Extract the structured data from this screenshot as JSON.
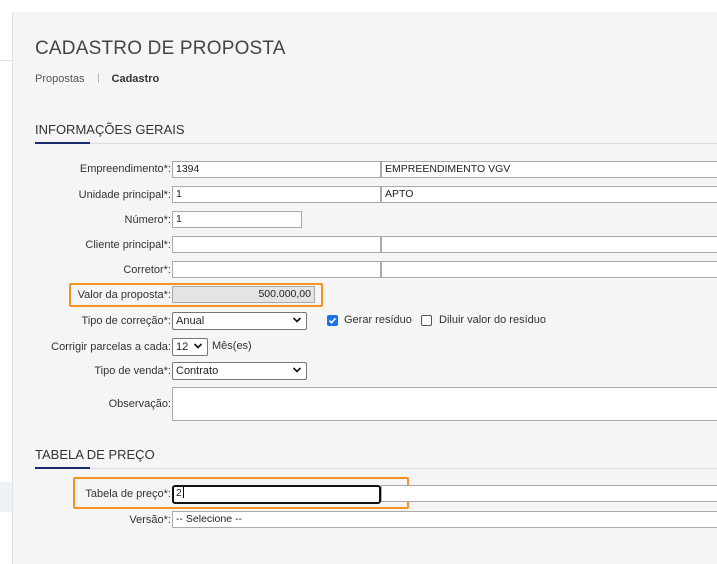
{
  "page": {
    "title": "CADASTRO DE PROPOSTA",
    "breadcrumb": [
      "Propostas",
      "Cadastro"
    ]
  },
  "general": {
    "section_title": "INFORMAÇÕES GERAIS",
    "empreendimento": {
      "label": "Empreendimento*:",
      "code": "1394",
      "name": "EMPREENDIMENTO VGV"
    },
    "unidade": {
      "label": "Unidade principal*:",
      "code": "1",
      "name": "APTO"
    },
    "numero": {
      "label": "Número*:",
      "value": "1"
    },
    "cliente": {
      "label": "Cliente principal*:",
      "code": "",
      "name": ""
    },
    "corretor": {
      "label": "Corretor*:",
      "code": "",
      "name": ""
    },
    "valor": {
      "label": "Valor da proposta*:",
      "value": "500.000,00"
    },
    "correcao": {
      "label": "Tipo de correção*:",
      "value": "Anual"
    },
    "gerar_residuo": {
      "label": "Gerar resíduo",
      "checked": true
    },
    "diluir_residuo": {
      "label": "Diluir valor do resíduo",
      "checked": false
    },
    "parcelas": {
      "label": "Corrigir parcelas a cada:",
      "value": "12",
      "unit": "Mês(es)"
    },
    "tipo_venda": {
      "label": "Tipo de venda*:",
      "value": "Contrato"
    },
    "observacao": {
      "label": "Observação:",
      "value": ""
    }
  },
  "price": {
    "section_title": "TABELA DE PREÇO",
    "tabela": {
      "label": "Tabela de preço*:",
      "value": "2",
      "name": ""
    },
    "versao": {
      "label": "Versão*:",
      "value": "-- Selecione --"
    }
  },
  "colors": {
    "accent": "#1a2a6c",
    "highlight": "#f39321",
    "checkbox": "#1a73e8"
  },
  "icons": [
    "chevron-down-icon",
    "checkmark-icon"
  ]
}
